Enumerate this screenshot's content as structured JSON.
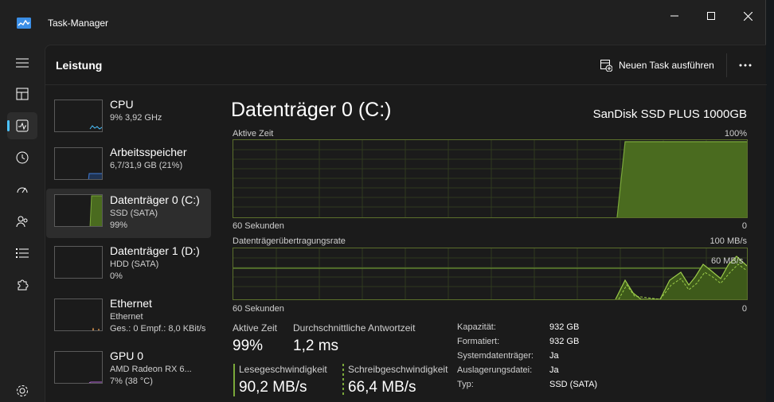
{
  "window": {
    "title": "Task-Manager"
  },
  "header": {
    "title": "Leistung",
    "run_task_label": "Neuen Task ausführen"
  },
  "devices": [
    {
      "name": "CPU",
      "line1": "9%  3,92 GHz"
    },
    {
      "name": "Arbeitsspeicher",
      "line1": "6,7/31,9 GB (21%)"
    },
    {
      "name": "Datenträger 0 (C:)",
      "line1": "SSD (SATA)",
      "line2": "99%"
    },
    {
      "name": "Datenträger 1 (D:)",
      "line1": "HDD (SATA)",
      "line2": "0%"
    },
    {
      "name": "Ethernet",
      "line1": "Ethernet",
      "line2": "Ges.: 0 Empf.: 8,0 KBit/s"
    },
    {
      "name": "GPU 0",
      "line1": "AMD Radeon RX 6...",
      "line2": "7%  (38 °C)"
    }
  ],
  "detail": {
    "title": "Datenträger 0 (C:)",
    "model": "SanDisk SSD PLUS 1000GB",
    "graph1": {
      "label": "Aktive Zeit",
      "max_label": "100%",
      "time_label": "60 Sekunden",
      "min_label": "0"
    },
    "graph2": {
      "label": "Datenträgerübertragungsrate",
      "max_label": "100 MB/s",
      "marker_label": "60 MB/s",
      "time_label": "60 Sekunden",
      "min_label": "0"
    },
    "stats": {
      "active_time_label": "Aktive Zeit",
      "active_time_value": "99%",
      "response_label": "Durchschnittliche Antwortzeit",
      "response_value": "1,2 ms",
      "read_label": "Lesegeschwindigkeit",
      "read_value": "90,2 MB/s",
      "write_label": "Schreibgeschwindigkeit",
      "write_value": "66,4 MB/s"
    },
    "properties": [
      {
        "key": "Kapazität:",
        "value": "932 GB"
      },
      {
        "key": "Formatiert:",
        "value": "932 GB"
      },
      {
        "key": "Systemdatenträger:",
        "value": "Ja"
      },
      {
        "key": "Auslagerungsdatei:",
        "value": "Ja"
      },
      {
        "key": "Typ:",
        "value": "SSD (SATA)"
      }
    ]
  },
  "colors": {
    "accent": "#4cc2ff",
    "disk": "#7aa83a",
    "memory": "#3f7bd6",
    "gpu": "#b565d8",
    "ethernet": "#c98a4a"
  }
}
